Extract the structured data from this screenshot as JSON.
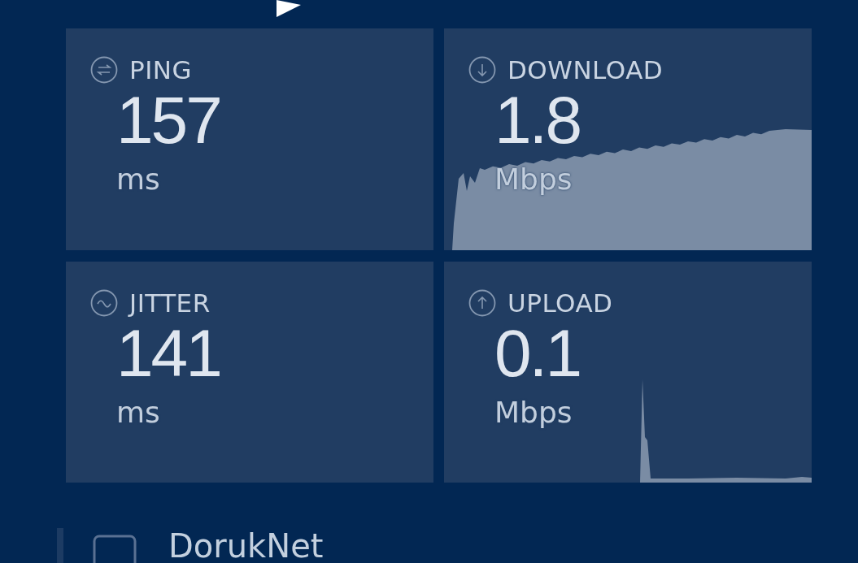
{
  "metrics": [
    {
      "kind": "ping",
      "label": "PING",
      "value": "157",
      "unit": "ms"
    },
    {
      "kind": "download",
      "label": "DOWNLOAD",
      "value": "1.8",
      "unit": "Mbps"
    },
    {
      "kind": "jitter",
      "label": "JITTER",
      "value": "141",
      "unit": "ms"
    },
    {
      "kind": "upload",
      "label": "UPLOAD",
      "value": "0.1",
      "unit": "Mbps"
    }
  ],
  "provider": {
    "name": "DorukNet"
  }
}
